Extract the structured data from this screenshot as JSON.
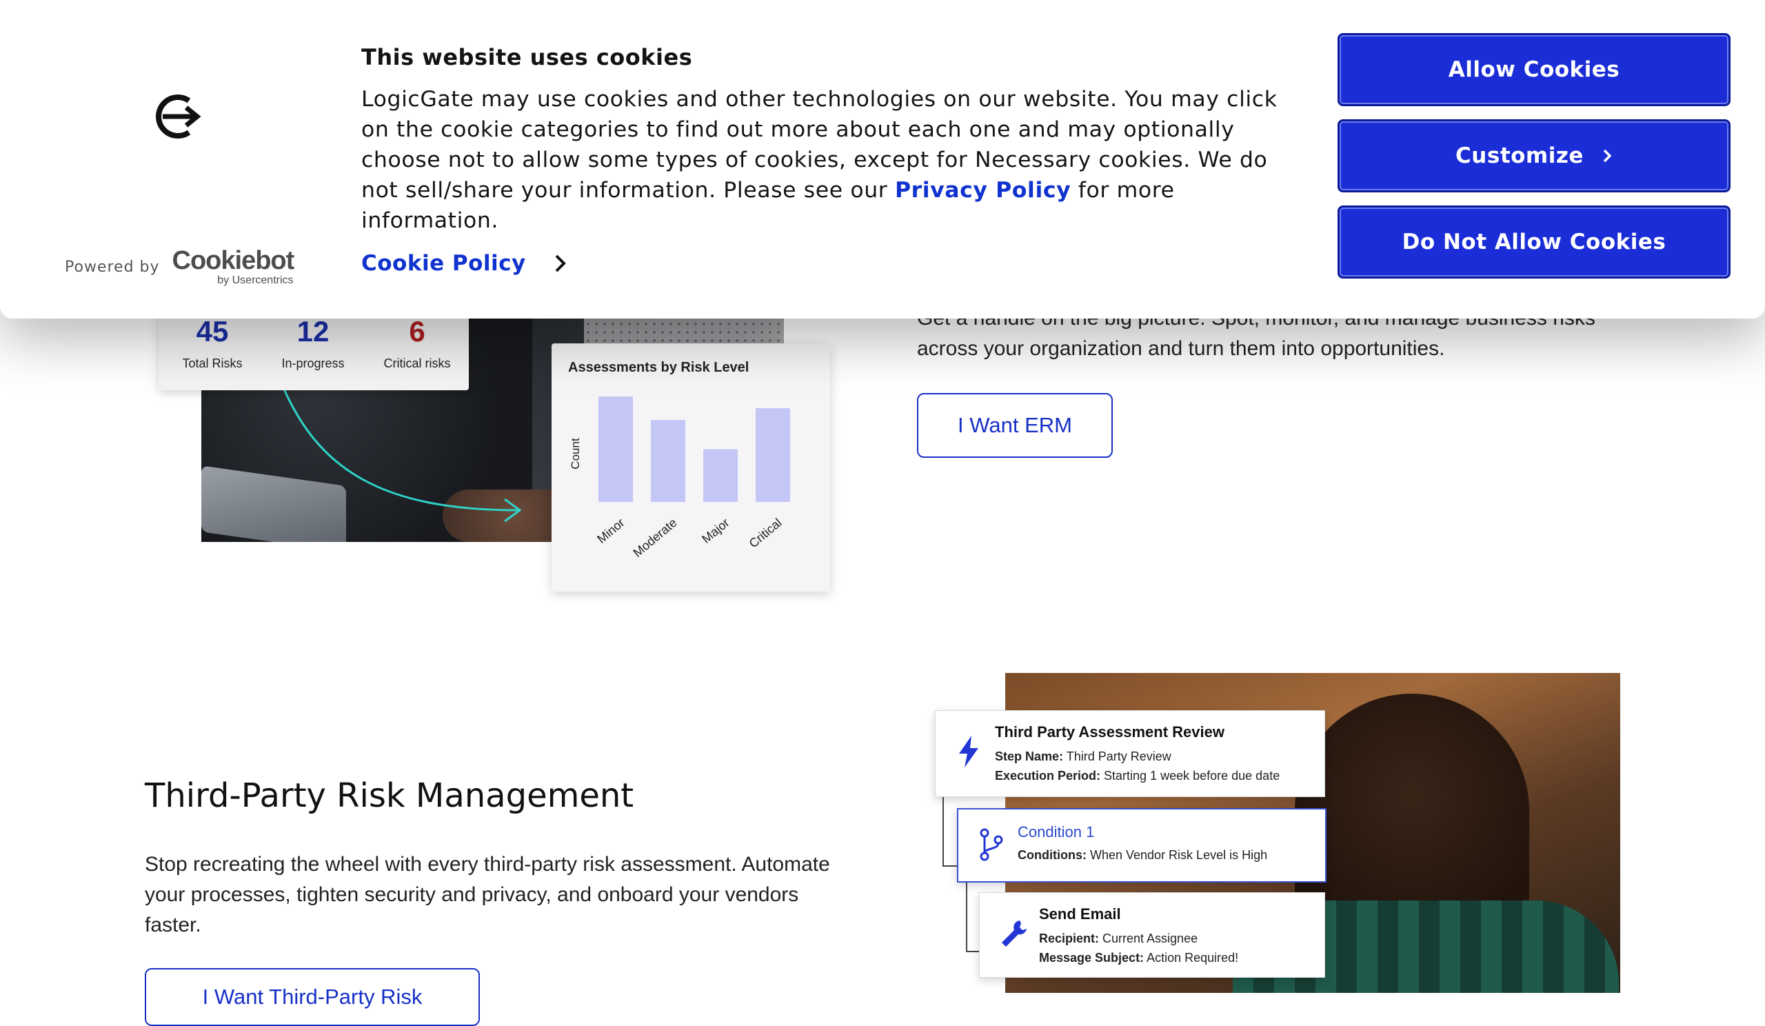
{
  "cookie_banner": {
    "title": "This website uses cookies",
    "text_before_link": "LogicGate may use cookies and other technologies on our website. You may click on the cookie categories to find out more about each one and may optionally choose not to allow some types of cookies, except for Necessary cookies.  We do not sell/share your information. Please see our ",
    "privacy_link": "Privacy Policy",
    "text_after_link": " for more information.",
    "powered_by": "Powered by",
    "cookiebot_wordmark": "Cookiebot",
    "cookiebot_sub": "by Usercentrics",
    "cookie_policy_link": "Cookie Policy",
    "buttons": {
      "allow": "Allow Cookies",
      "customize": "Customize",
      "deny": "Do Not Allow Cookies"
    },
    "accent_color": "#1a2dd6"
  },
  "erm": {
    "description": "Get a handle on the big picture. Spot, monitor, and manage business risks across your organization and turn them into opportunities.",
    "button": "I Want ERM",
    "stats": [
      {
        "value": "45",
        "label": "Total Risks",
        "color": "#1b2fa8"
      },
      {
        "value": "12",
        "label": "In-progress",
        "color": "#1b2fa8"
      },
      {
        "value": "6",
        "label": "Critical risks",
        "color": "#b01f1f"
      }
    ],
    "chart_card_title": "Assessments by Risk Level"
  },
  "chart_data": {
    "type": "bar",
    "title": "Assessments by Risk Level",
    "ylabel": "Count",
    "xlabel": "",
    "categories": [
      "Minor",
      "Moderate",
      "Major",
      "Critical"
    ],
    "values": [
      9,
      7,
      4.5,
      8
    ],
    "ylim": [
      0,
      10
    ],
    "bar_color": "#c4c6f6",
    "grid": false
  },
  "tprm": {
    "title": "Third-Party Risk Management",
    "description": "Stop recreating the wheel with every third-party risk assessment. Automate your processes, tighten security and privacy, and onboard your vendors faster.",
    "button": "I Want Third-Party Risk",
    "workflow": [
      {
        "title": "Third Party Assessment Review",
        "k1": "Step Name:",
        "v1": " Third Party Review",
        "k2": "Execution Period:",
        "v2": " Starting 1 week before due date",
        "icon": "lightning-icon"
      },
      {
        "title": "Condition 1",
        "k1": "Conditions:",
        "v1": " When Vendor Risk Level is High",
        "icon": "branch-icon"
      },
      {
        "title": "Send Email",
        "k1": "Recipient:",
        "v1": " Current Assignee",
        "k2": "Message Subject:",
        "v2": " Action Required!",
        "icon": "wrench-icon"
      }
    ]
  }
}
